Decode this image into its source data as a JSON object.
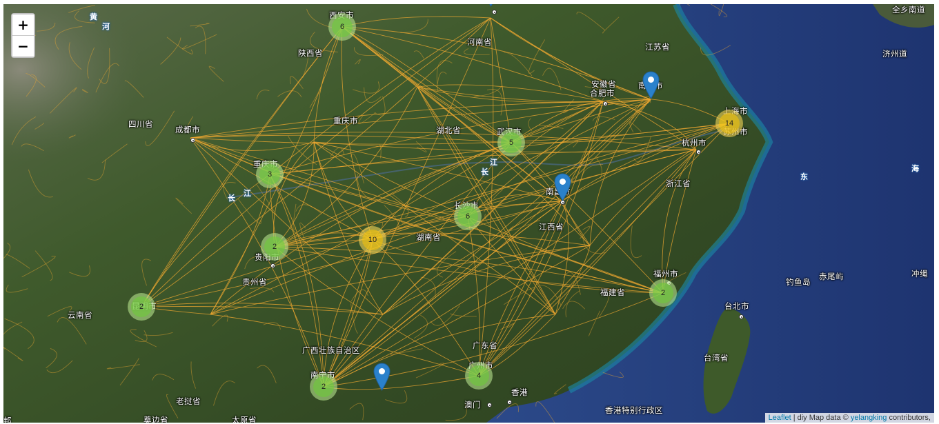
{
  "zoom": {
    "in_label": "+",
    "out_label": "−"
  },
  "labels": [
    {
      "id": "yellow-river-1",
      "text": "黄",
      "kind": "water"
    },
    {
      "id": "yellow-river-2",
      "text": "河",
      "kind": "water"
    },
    {
      "id": "xian",
      "text": "西安市",
      "kind": "city"
    },
    {
      "id": "shaanxi",
      "text": "陕西省",
      "kind": "province"
    },
    {
      "id": "henan",
      "text": "河南省",
      "kind": "province"
    },
    {
      "id": "jiangsu",
      "text": "江苏省",
      "kind": "province"
    },
    {
      "id": "shanghai-province-top",
      "text": "全乡南道",
      "kind": "province"
    },
    {
      "id": "jeju",
      "text": "济州道",
      "kind": "province"
    },
    {
      "id": "anhui",
      "text": "安徽省",
      "kind": "province"
    },
    {
      "id": "hefei",
      "text": "合肥市",
      "kind": "city"
    },
    {
      "id": "nanjing",
      "text": "南京市",
      "kind": "city"
    },
    {
      "id": "shanghai",
      "text": "上海市",
      "kind": "city"
    },
    {
      "id": "suzhou",
      "text": "苏州市",
      "kind": "city"
    },
    {
      "id": "sichuan",
      "text": "四川省",
      "kind": "province"
    },
    {
      "id": "chengdu",
      "text": "成都市",
      "kind": "city"
    },
    {
      "id": "chongqing-top",
      "text": "重庆市",
      "kind": "city"
    },
    {
      "id": "hubei",
      "text": "湖北省",
      "kind": "province"
    },
    {
      "id": "wuhan",
      "text": "武汉市",
      "kind": "city"
    },
    {
      "id": "hangzhou",
      "text": "杭州市",
      "kind": "city"
    },
    {
      "id": "yangtze-1",
      "text": "江",
      "kind": "water"
    },
    {
      "id": "yangtze-2",
      "text": "长",
      "kind": "water"
    },
    {
      "id": "east-sea-1",
      "text": "东",
      "kind": "water"
    },
    {
      "id": "east-sea-2",
      "text": "海",
      "kind": "water"
    },
    {
      "id": "chongqing",
      "text": "重庆市",
      "kind": "city"
    },
    {
      "id": "yangtze-3",
      "text": "长",
      "kind": "water"
    },
    {
      "id": "yangtze-4",
      "text": "江",
      "kind": "water"
    },
    {
      "id": "nanchang",
      "text": "南昌市",
      "kind": "city"
    },
    {
      "id": "zhejiang",
      "text": "浙江省",
      "kind": "province"
    },
    {
      "id": "changsha",
      "text": "长沙市",
      "kind": "city"
    },
    {
      "id": "jiangxi",
      "text": "江西省",
      "kind": "province"
    },
    {
      "id": "hunan",
      "text": "湖南省",
      "kind": "province"
    },
    {
      "id": "guiyang",
      "text": "贵阳市",
      "kind": "city"
    },
    {
      "id": "guizhou",
      "text": "贵州省",
      "kind": "province"
    },
    {
      "id": "fuzhou",
      "text": "福州市",
      "kind": "city"
    },
    {
      "id": "fujian",
      "text": "福建省",
      "kind": "province"
    },
    {
      "id": "diaoyu",
      "text": "钓鱼岛",
      "kind": "city"
    },
    {
      "id": "chiwei",
      "text": "赤尾屿",
      "kind": "city"
    },
    {
      "id": "okinawa",
      "text": "冲绳",
      "kind": "province"
    },
    {
      "id": "kunming",
      "text": "昆明市",
      "kind": "city"
    },
    {
      "id": "yunnan",
      "text": "云南省",
      "kind": "province"
    },
    {
      "id": "taipei",
      "text": "台北市",
      "kind": "city"
    },
    {
      "id": "taiwan",
      "text": "台湾省",
      "kind": "province"
    },
    {
      "id": "guangdong",
      "text": "广东省",
      "kind": "province"
    },
    {
      "id": "guangxi",
      "text": "广西壮族自治区",
      "kind": "province"
    },
    {
      "id": "guangzhou",
      "text": "广州市",
      "kind": "city"
    },
    {
      "id": "nanning",
      "text": "南宁市",
      "kind": "city"
    },
    {
      "id": "hongkong",
      "text": "香港",
      "kind": "city"
    },
    {
      "id": "macau",
      "text": "澳门",
      "kind": "city"
    },
    {
      "id": "hk-sar",
      "text": "香港特别行政区",
      "kind": "province"
    },
    {
      "id": "laos",
      "text": "老挝省",
      "kind": "province"
    },
    {
      "id": "vientiane",
      "text": "奠边省",
      "kind": "province"
    },
    {
      "id": "taiyuan",
      "text": "太原省",
      "kind": "province"
    },
    {
      "id": "bang",
      "text": "邦",
      "kind": "province"
    }
  ],
  "clusters": [
    {
      "id": "xian",
      "count": "6",
      "size": "small"
    },
    {
      "id": "shanghai",
      "count": "14",
      "size": "medium"
    },
    {
      "id": "wuhan",
      "count": "5",
      "size": "small"
    },
    {
      "id": "chongqing",
      "count": "3",
      "size": "small"
    },
    {
      "id": "changsha",
      "count": "6",
      "size": "small"
    },
    {
      "id": "hunan-west",
      "count": "10",
      "size": "medium"
    },
    {
      "id": "guiyang",
      "count": "2",
      "size": "small"
    },
    {
      "id": "kunming",
      "count": "2",
      "size": "small"
    },
    {
      "id": "fuzhou",
      "count": "2",
      "size": "small"
    },
    {
      "id": "guangzhou",
      "count": "4",
      "size": "small"
    },
    {
      "id": "nanning",
      "count": "2",
      "size": "small"
    }
  ],
  "markers": [
    {
      "id": "nanjing"
    },
    {
      "id": "nanchang"
    },
    {
      "id": "guangxi-south"
    },
    {
      "id": "henan-top"
    }
  ],
  "attribution": {
    "leaflet": "Leaflet",
    "separator": " | diy Map data © ",
    "author": "yelangking",
    "suffix": " contributors,"
  },
  "colors": {
    "land": "#3a4a2a",
    "sea": "#2c4a8a",
    "road": "#f0a830",
    "cluster_small": "#6ecc39",
    "cluster_medium": "#f0c20c",
    "marker": "#2a81cb"
  }
}
